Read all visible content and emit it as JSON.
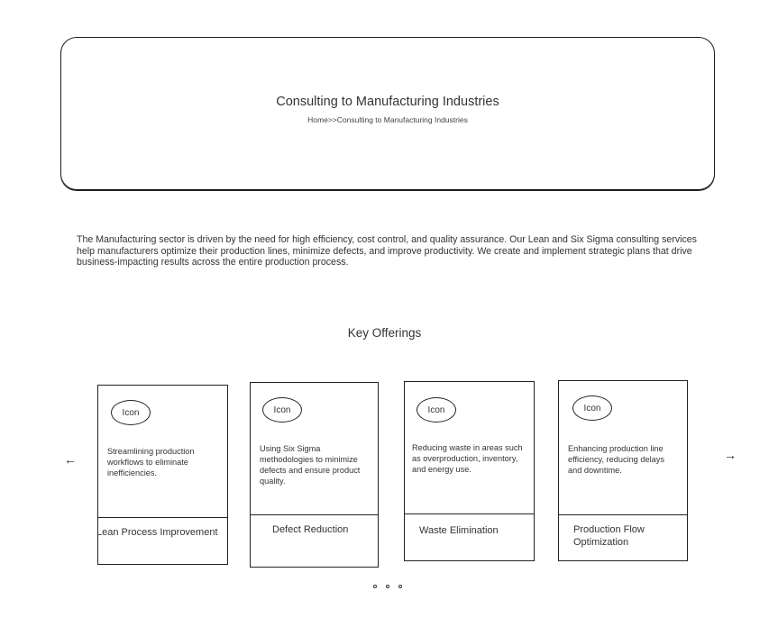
{
  "hero": {
    "title": "Consulting  to Manufacturing Industries",
    "breadcrumb": {
      "home": "Home",
      "separator": ">>",
      "current": "Consulting  to Manufacturing Industries"
    }
  },
  "intro": "The Manufacturing sector  is driven by the need for high efficiency, cost control, and quality assurance. Our Lean and Six Sigma consulting services help manufacturers optimize their production lines, minimize defects, and improve productivity. We create and implement strategic plans that drive business-impacting results across the entire production process.",
  "offerings": {
    "title": "Key Offerings",
    "prev_icon": "←",
    "next_icon": "→",
    "cards": [
      {
        "icon_label": "Icon",
        "description": "Streamlining production workflows to eliminate inefficiencies.",
        "name": "Lean Process Improvement"
      },
      {
        "icon_label": "Icon",
        "description": "Using Six Sigma methodologies to minimize defects and ensure product quality.",
        "name": "Defect Reduction"
      },
      {
        "icon_label": "Icon",
        "description": "Reducing waste in areas such as overproduction, inventory, and energy use.",
        "name": "Waste Elimination"
      },
      {
        "icon_label": "Icon",
        "description": "Enhancing production line efficiency, reducing delays and downtime.",
        "name": "Production Flow Optimization"
      }
    ],
    "page_count": 3
  }
}
